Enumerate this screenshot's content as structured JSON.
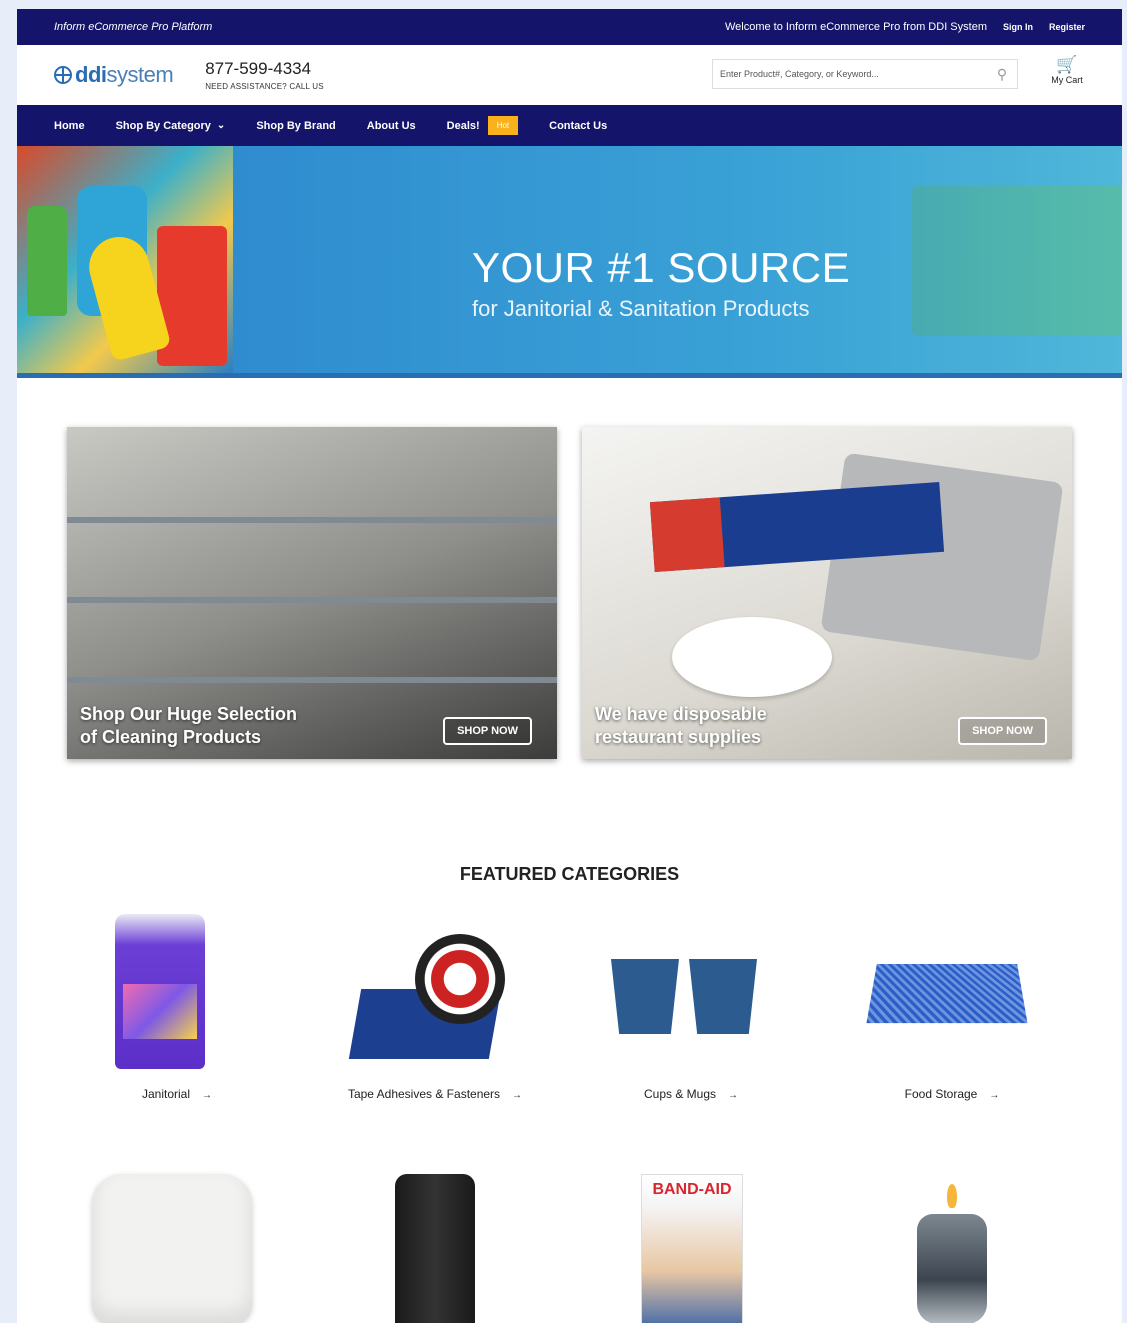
{
  "topbar": {
    "brand": "Inform eCommerce Pro Platform",
    "welcome": "Welcome to Inform eCommerce Pro from DDI System",
    "sign_in": "Sign In",
    "register": "Register"
  },
  "header": {
    "logo_bold": "ddi",
    "logo_light": "system",
    "phone": "877-599-4334",
    "phone_sub": "NEED ASSISTANCE? CALL US",
    "search_placeholder": "Enter Product#, Category, or Keyword...",
    "cart_label": "My Cart"
  },
  "nav": {
    "home": "Home",
    "shop_by_category": "Shop By Category",
    "shop_by_brand": "Shop By Brand",
    "about": "About Us",
    "deals": "Deals!",
    "hot_badge": "Hot",
    "contact": "Contact Us"
  },
  "hero": {
    "title": "YOUR #1 SOURCE",
    "subtitle": "for Janitorial & Sanitation Products"
  },
  "promos": [
    {
      "caption_line1": "Shop Our Huge Selection",
      "caption_line2": "of Cleaning Products",
      "button": "SHOP NOW"
    },
    {
      "caption_line1": "We have disposable",
      "caption_line2": "restaurant supplies",
      "button": "SHOP NOW"
    }
  ],
  "featured": {
    "title": "FEATURED CATEGORIES",
    "categories": [
      {
        "label": "Janitorial"
      },
      {
        "label": "Tape Adhesives & Fasteners"
      },
      {
        "label": "Cups & Mugs"
      },
      {
        "label": "Food Storage"
      }
    ],
    "arrow": "→"
  },
  "colors": {
    "navy": "#14146b",
    "accent_blue": "#2a6db2",
    "hot_badge": "#f9b21c"
  },
  "icons": {
    "search": "search-icon",
    "cart": "cart-icon",
    "chevron": "chevron-down-icon",
    "arrow": "arrow-right-icon"
  }
}
